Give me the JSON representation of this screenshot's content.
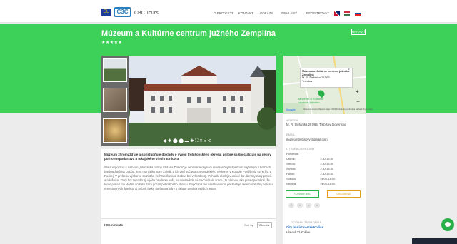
{
  "nav": {
    "eu_label": "EU",
    "logo": "C3C",
    "brand": "CBC Tours",
    "items": [
      "O PROJEKTE",
      "KONTAKT",
      "ODKAZY",
      "PRIHLÁSIŤ",
      "REGISTROVAŤ"
    ]
  },
  "hero": {
    "title": "Múzeum a Kultúrne centrum južného Zemplína",
    "stars": "★★★★★",
    "edit": "UPRAVIŤ"
  },
  "gallery": {
    "controls": "◆ ✚ ⬤ ⬤ ▬ ✚ ⛶ ✕ ⌕ ⟲"
  },
  "article": {
    "intro": "Múzeum zhromažďuje a sprístupňuje doklady o vývoji trebišovského okresu, prírore sa špecializuje na dejiny poľnohospodárstva a tokajského vinohradníctva.",
    "body": "Stála expozícia s názvom „Wandiska rodiny Štefana Dobóa“ je venovaná dejinám renesančným šperkom nájdeným v hrobech baróna Štefana Dobóa, jeho manželky Sáry Zolyák a ich detí počas archeologického výskumu v Kostole Povýšenia sv. Kríža v Ruskej. V prebehu výskumu sa zistilo, že hrob Štefana Dobóa bol vykradnutý. Pohľadu zlodejov unikol iba dámsky zlatý prsteň a náušnice, ktorý bol zapadnutý v jeho hrudnom koši, na mieste kde sa nachádzalo srdce. Je ním vec ako prostepodobné, že tento prsteň mu vložila do šatu Sára počas pohrebného obradu. Expozícia tak návštevníkom prezentuje okrem unikátny náleziu renesančných šperkov aj príbeh lásky Štefana a Sáry v sklabé predkonvejších lesan."
  },
  "comments": {
    "count": "0 Comments",
    "sort_label": "Sort by",
    "sort_value": "Oldest ▾"
  },
  "map": {
    "popup_title": "Múzeum a Kultúrne centrum južného Zemplína",
    "popup_addr": "M. R. Štefánika 257/65",
    "popup_city": "Trebišov",
    "pin_label": "Múzeum a Kultúrne centrum južného...",
    "attribution": "Klávesové skratky   Mapové údaje ©2020   Podmienky používania   Nahlásiť chybu mapy"
  },
  "details": {
    "address_label": "ADRESA",
    "address": "M. R. Štefánika 257/65, Trebišov Slovensko",
    "email_label": "EMAIL",
    "email": "muzeumtrebisovy@gmail.com",
    "hours_label": "OTVÁRACIE HODINY",
    "days": [
      "Pondelok:",
      "Utorok:",
      "Streda:",
      "Štvrtok:",
      "Piatok:",
      "Sobota:",
      "Nedeľa:"
    ],
    "times": [
      "",
      "7:30-15:30",
      "7:30-15:30",
      "7:30-15:30",
      "7:30-15:30",
      "14:00-18:00",
      "14:00-18:00"
    ],
    "btn_route": "TU SOM BOL",
    "btn_fav": "OBĽÚBENÉ",
    "related_label": "ZOZNAM ZARIADENIA",
    "related_name": "City tourist centre Košice",
    "related_addr": "Hlavná 32 Košice"
  },
  "colors": {
    "hero": "#3ed15a",
    "accent": "#2ab04a",
    "link": "#1a6fc4"
  }
}
